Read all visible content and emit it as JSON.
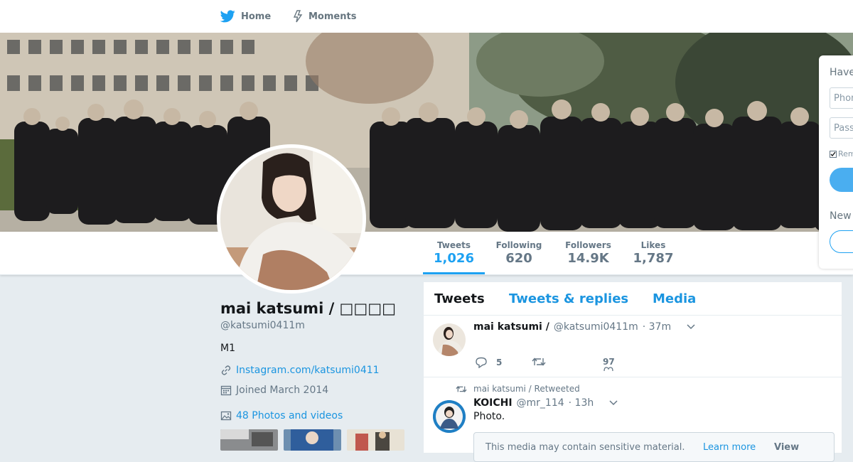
{
  "nav": {
    "home_label": "Home",
    "moments_label": "Moments"
  },
  "stats": [
    {
      "label": "Tweets",
      "value": "1,026"
    },
    {
      "label": "Following",
      "value": "620"
    },
    {
      "label": "Followers",
      "value": "14.9K"
    },
    {
      "label": "Likes",
      "value": "1,787"
    }
  ],
  "profile": {
    "name": "mai katsumi / □□□□",
    "handle": "@katsumi0411m",
    "bio": "M1",
    "website": "Instagram.com/katsumi0411",
    "joined": "Joined March 2014",
    "photos_label": "48 Photos and videos"
  },
  "timeline": {
    "tabs": [
      "Tweets",
      "Tweets & replies",
      "Media"
    ]
  },
  "tweets": [
    {
      "name": "mai katsumi /",
      "handle": "@katsumi0411m",
      "time": "· 37m",
      "replies": "5",
      "likes": "97"
    },
    {
      "retweet_note": "mai katsumi /  Retweeted",
      "name": "KOICHI",
      "handle": "@mr_114",
      "time": "· 13h",
      "text": "Photo.",
      "sensitive_text": "This media may contain sensitive material.",
      "learn_more": "Learn more",
      "view_label": "View"
    }
  ],
  "login": {
    "heading": "Have",
    "phone_placeholder": "Phon",
    "password_placeholder": "Pass",
    "remember": "Rem",
    "new_label": "New"
  },
  "colors": {
    "accent": "#1da1f2",
    "background": "#e6ecf0"
  }
}
